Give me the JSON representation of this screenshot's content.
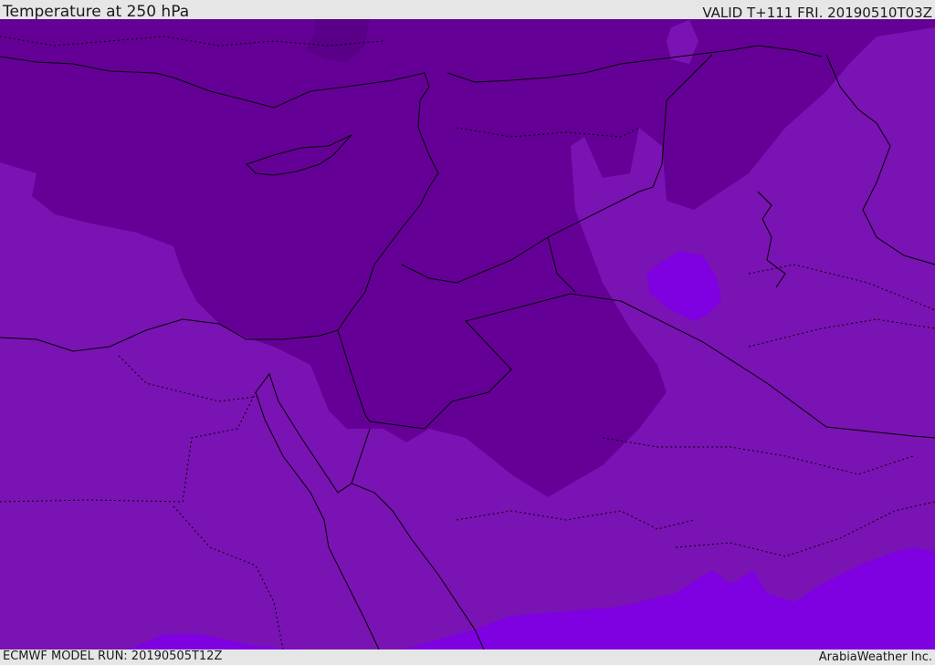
{
  "header": {
    "title": "Temperature at 250 hPa",
    "valid_time": "VALID T+111 FRI. 20190510T03Z"
  },
  "footer": {
    "model_run": "ECMWF MODEL RUN: 20190505T12Z",
    "credit": "ArabiaWeather Inc."
  },
  "map": {
    "variable": "temperature",
    "level": "250 hPa",
    "colors": {
      "background_band": "#7a13b3",
      "cold_core": "#650096",
      "warm_patches": "#7f00e0",
      "darkest_spot": "#5a0088",
      "coastlines": "#000000",
      "borders": "#000000"
    }
  }
}
